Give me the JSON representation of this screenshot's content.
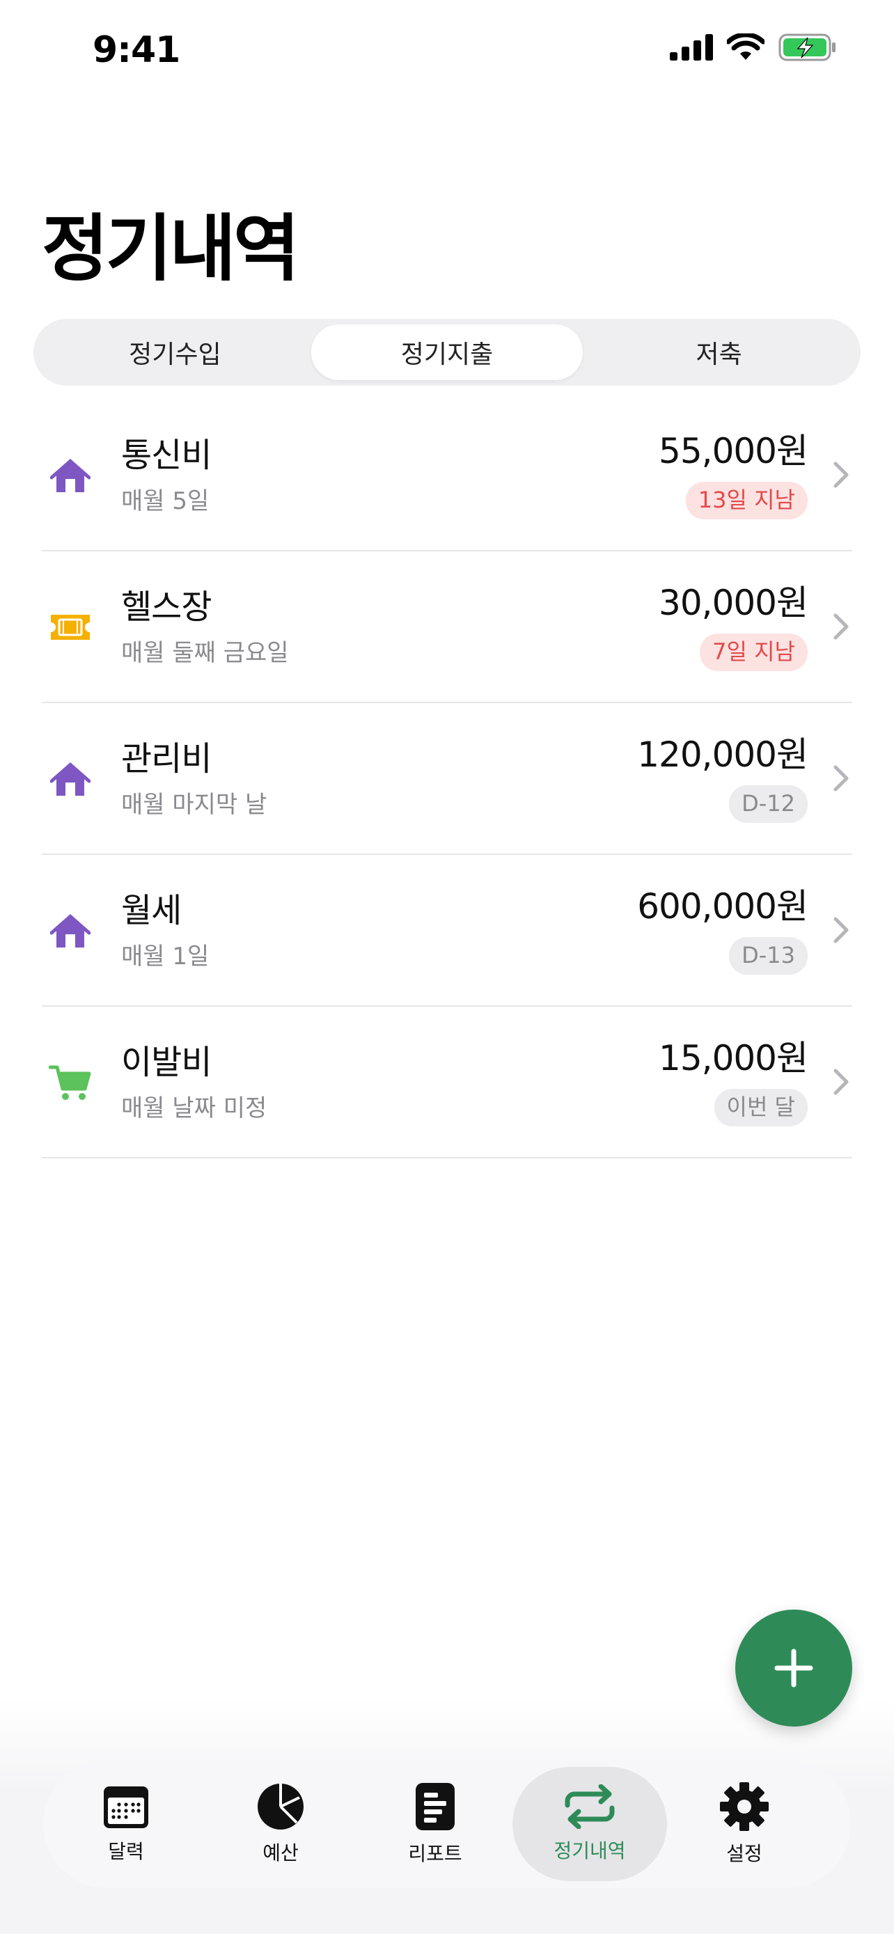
{
  "status_bar": {
    "time": "9:41"
  },
  "page_title": "정기내역",
  "segments": [
    {
      "label": "정기수입"
    },
    {
      "label": "정기지출"
    },
    {
      "label": "저축"
    }
  ],
  "selected_segment": "정기지출",
  "items": [
    {
      "name": "통신비",
      "schedule": "매월 5일",
      "amount": "55,000원",
      "badge": "13일 지남",
      "badge_type": "overdue",
      "icon": "house-icon"
    },
    {
      "name": "헬스장",
      "schedule": "매월 둘째 금요일",
      "amount": "30,000원",
      "badge": "7일 지남",
      "badge_type": "overdue",
      "icon": "ticket-icon"
    },
    {
      "name": "관리비",
      "schedule": "매월 마지막 날",
      "amount": "120,000원",
      "badge": "D-12",
      "badge_type": "upcoming",
      "icon": "house-icon"
    },
    {
      "name": "월세",
      "schedule": "매월 1일",
      "amount": "600,000원",
      "badge": "D-13",
      "badge_type": "upcoming",
      "icon": "house-icon"
    },
    {
      "name": "이발비",
      "schedule": "매월 날짜 미정",
      "amount": "15,000원",
      "badge": "이번 달",
      "badge_type": "upcoming",
      "icon": "cart-icon"
    }
  ],
  "tabs": [
    {
      "label": "달력",
      "icon": "calendar-icon"
    },
    {
      "label": "예산",
      "icon": "pie-chart-icon"
    },
    {
      "label": "리포트",
      "icon": "report-icon"
    },
    {
      "label": "정기내역",
      "icon": "repeat-icon"
    },
    {
      "label": "설정",
      "icon": "gear-icon"
    }
  ],
  "active_tab": "정기내역",
  "colors": {
    "accent": "#2e8b57",
    "house_icon": "#7e57c2",
    "ticket_icon": "#f5b000",
    "cart_icon": "#5cc25c",
    "overdue_bg": "#fde2e2",
    "overdue_text": "#e14a4a",
    "upcoming_bg": "#ececee",
    "upcoming_text": "#8a8a8e",
    "battery": "#34c759"
  }
}
